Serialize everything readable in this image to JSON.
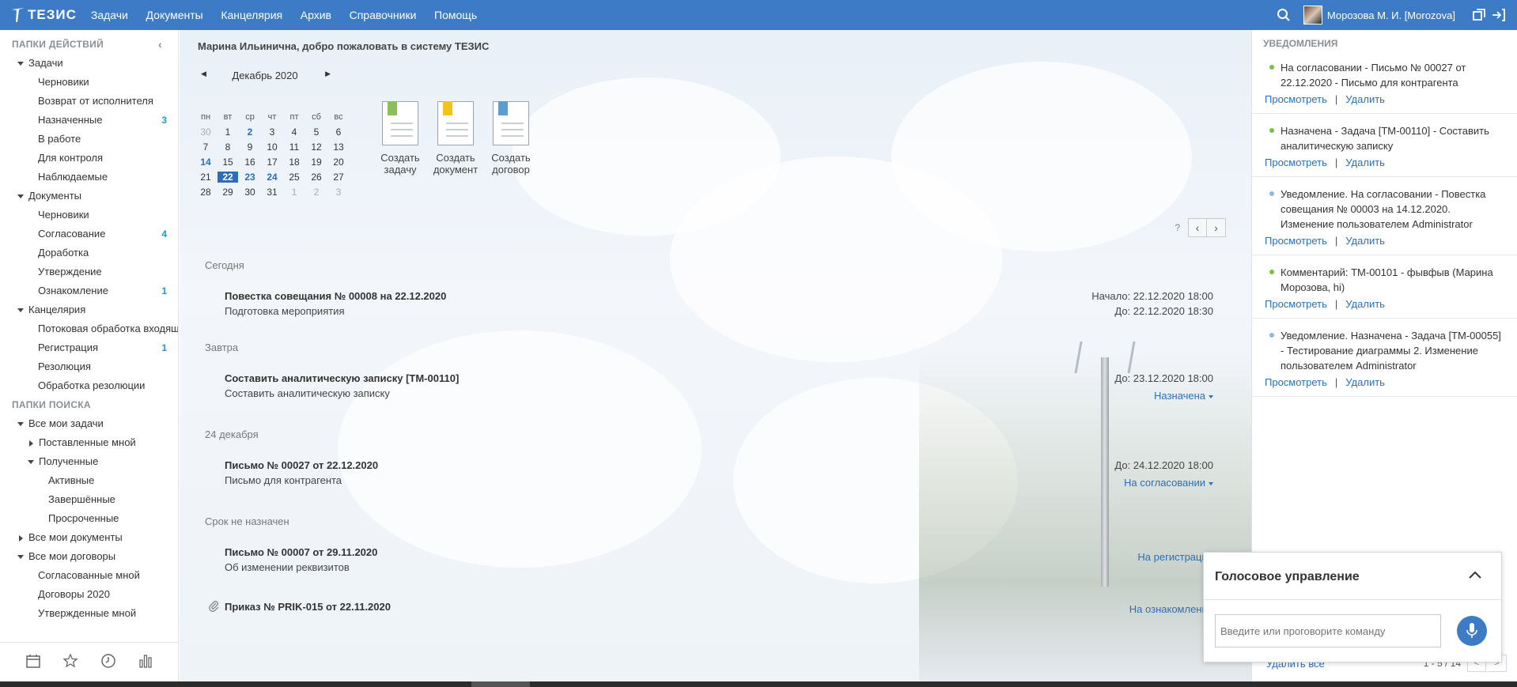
{
  "brand": {
    "name": "ТЕЗИС"
  },
  "nav": [
    "Задачи",
    "Документы",
    "Канцелярия",
    "Архив",
    "Справочники",
    "Помощь"
  ],
  "user": {
    "name": "Морозова М. И. [Morozova]"
  },
  "sidebar": {
    "actions_title": "ПАПКИ ДЕЙСТВИЙ",
    "search_title": "ПАПКИ ПОИСКА",
    "tasks": {
      "label": "Задачи",
      "items": [
        {
          "label": "Черновики",
          "count": ""
        },
        {
          "label": "Возврат от исполнителя",
          "count": ""
        },
        {
          "label": "Назначенные",
          "count": "3"
        },
        {
          "label": "В работе",
          "count": ""
        },
        {
          "label": "Для контроля",
          "count": ""
        },
        {
          "label": "Наблюдаемые",
          "count": ""
        }
      ]
    },
    "documents": {
      "label": "Документы",
      "items": [
        {
          "label": "Черновики",
          "count": ""
        },
        {
          "label": "Согласование",
          "count": "4"
        },
        {
          "label": "Доработка",
          "count": ""
        },
        {
          "label": "Утверждение",
          "count": ""
        },
        {
          "label": "Ознакомление",
          "count": "1"
        }
      ]
    },
    "office": {
      "label": "Канцелярия",
      "items": [
        {
          "label": "Потоковая обработка входящ",
          "count": ""
        },
        {
          "label": "Регистрация",
          "count": "1"
        },
        {
          "label": "Резолюция",
          "count": ""
        },
        {
          "label": "Обработка резолюции",
          "count": ""
        }
      ]
    },
    "my_tasks": {
      "label": "Все мои задачи",
      "set_by_me": "Поставленные мной",
      "received": "Полученные",
      "received_items": [
        "Активные",
        "Завершённые",
        "Просроченные"
      ]
    },
    "my_docs": "Все мои документы",
    "my_contracts": {
      "label": "Все мои договоры",
      "items": [
        "Согласованные мной",
        "Договоры 2020",
        "Утвержденные мной"
      ]
    }
  },
  "main": {
    "welcome": "Марина Ильинична, добро пожаловать в систему ТЕЗИС",
    "calendar": {
      "title": "Декабрь 2020",
      "weekdays": [
        "пн",
        "вт",
        "ср",
        "чт",
        "пт",
        "сб",
        "вс"
      ],
      "weeks": [
        [
          "30",
          "1",
          "2",
          "3",
          "4",
          "5",
          "6"
        ],
        [
          "7",
          "8",
          "9",
          "10",
          "11",
          "12",
          "13"
        ],
        [
          "14",
          "15",
          "16",
          "17",
          "18",
          "19",
          "20"
        ],
        [
          "21",
          "22",
          "23",
          "24",
          "25",
          "26",
          "27"
        ],
        [
          "28",
          "29",
          "30",
          "31",
          "1",
          "2",
          "3"
        ]
      ]
    },
    "create": [
      {
        "label1": "Создать",
        "label2": "задачу"
      },
      {
        "label1": "Создать",
        "label2": "документ"
      },
      {
        "label1": "Создать",
        "label2": "договор"
      }
    ],
    "help": "?",
    "groups": {
      "today": "Сегодня",
      "tomorrow": "Завтра",
      "dec24": "24 декабря",
      "nodue": "Срок не назначен"
    },
    "events": [
      {
        "title": "Повестка совещания № 00008 на 22.12.2020",
        "sub": "Подготовка мероприятия",
        "right1": "Начало: 22.12.2020 18:00",
        "right2": "До: 22.12.2020 18:30",
        "status": ""
      },
      {
        "title": "Составить аналитическую записку [ТМ-00110]",
        "sub": "Составить аналитическую записку",
        "right1": "До: 23.12.2020 18:00",
        "right2": "",
        "status": "Назначена"
      },
      {
        "title": "Письмо № 00027 от 22.12.2020",
        "sub": "Письмо для контрагента",
        "right1": "До: 24.12.2020 18:00",
        "right2": "",
        "status": "На согласовании"
      },
      {
        "title": "Письмо № 00007 от 29.11.2020",
        "sub": "Об изменении реквизитов",
        "right1": "",
        "right2": "",
        "status": "На регистрации"
      },
      {
        "title": "Приказ № PRIK-015 от 22.11.2020",
        "sub": "",
        "right1": "",
        "right2": "",
        "status": "На ознакомлении"
      }
    ]
  },
  "notifications": {
    "title": "УВЕДОМЛЕНИЯ",
    "view": "Просмотреть",
    "delete": "Удалить",
    "items": [
      {
        "text": "На согласовании - Письмо № 00027 от 22.12.2020 - Письмо для контрагента",
        "color": "#7cbf3f"
      },
      {
        "text": "Назначена - Задача [ТМ-00110] - Составить аналитическую записку",
        "color": "#7cbf3f"
      },
      {
        "text": "Уведомление. На согласовании - Повестка совещания № 00003 на 14.12.2020. Изменение пользователем Administrator",
        "color": "#8fb8d8"
      },
      {
        "text": "Комментарий: ТМ-00101 - фывфыв (Марина Морозова, hi)",
        "color": "#7cbf3f"
      },
      {
        "text": "Уведомление. Назначена - Задача [ТМ-00055] - Тестирование диаграммы 2. Изменение пользователем Administrator",
        "color": "#8fb8d8"
      }
    ],
    "delete_all": "Удалить все",
    "page": "1 - 5 / 14"
  },
  "voice": {
    "title": "Голосовое управление",
    "placeholder": "Введите или проговорите команду"
  },
  "colors": {
    "accent": "#3d7bc6",
    "count": "#1a9ad6",
    "link": "#2b6fba"
  }
}
